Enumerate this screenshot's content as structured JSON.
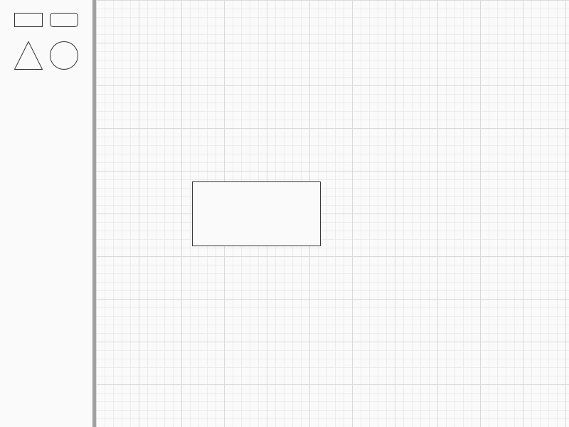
{
  "colors": {
    "background": "#fafafa",
    "divider": "#a0a0a0",
    "shape_stroke": "#333333",
    "grid_major": "#d9d9d9",
    "grid_minor": "#ececec"
  },
  "palette": {
    "tools": [
      {
        "name": "rectangle",
        "icon": "rectangle-icon"
      },
      {
        "name": "rounded-rectangle",
        "icon": "rounded-rectangle-icon"
      },
      {
        "name": "triangle",
        "icon": "triangle-icon"
      },
      {
        "name": "circle",
        "icon": "circle-icon"
      }
    ]
  },
  "canvas": {
    "grid": true,
    "shapes": [
      {
        "type": "rectangle"
      }
    ]
  }
}
